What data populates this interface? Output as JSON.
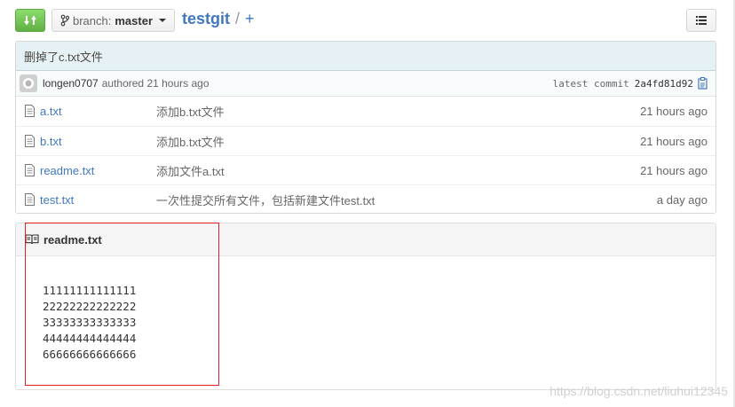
{
  "topbar": {
    "branch_prefix": "branch:",
    "branch_name": "master",
    "repo_name": "testgit",
    "path_separator": "/",
    "add_file": "+"
  },
  "commit": {
    "message": "删掉了c.txt文件",
    "author": "longen0707",
    "authored_time": "authored 21 hours ago",
    "latest_label": "latest commit",
    "sha": "2a4fd81d92"
  },
  "files": [
    {
      "name": "a.txt",
      "message": "添加b.txt文件",
      "age": "21 hours ago"
    },
    {
      "name": "b.txt",
      "message": "添加b.txt文件",
      "age": "21 hours ago"
    },
    {
      "name": "readme.txt",
      "message": "添加文件a.txt",
      "age": "21 hours ago"
    },
    {
      "name": "test.txt",
      "message": "一次性提交所有文件，包括新建文件test.txt",
      "age": "a day ago"
    }
  ],
  "readme": {
    "title": "readme.txt",
    "lines": [
      "11111111111111",
      "22222222222222",
      "33333333333333",
      "44444444444444",
      "66666666666666"
    ]
  },
  "watermark": "https://blog.csdn.net/liuhui12345",
  "colors": {
    "accent_green": "#60b044",
    "link_blue": "#4078c0",
    "commit_bg": "#e6f1f6",
    "highlight_red": "#e02020"
  }
}
